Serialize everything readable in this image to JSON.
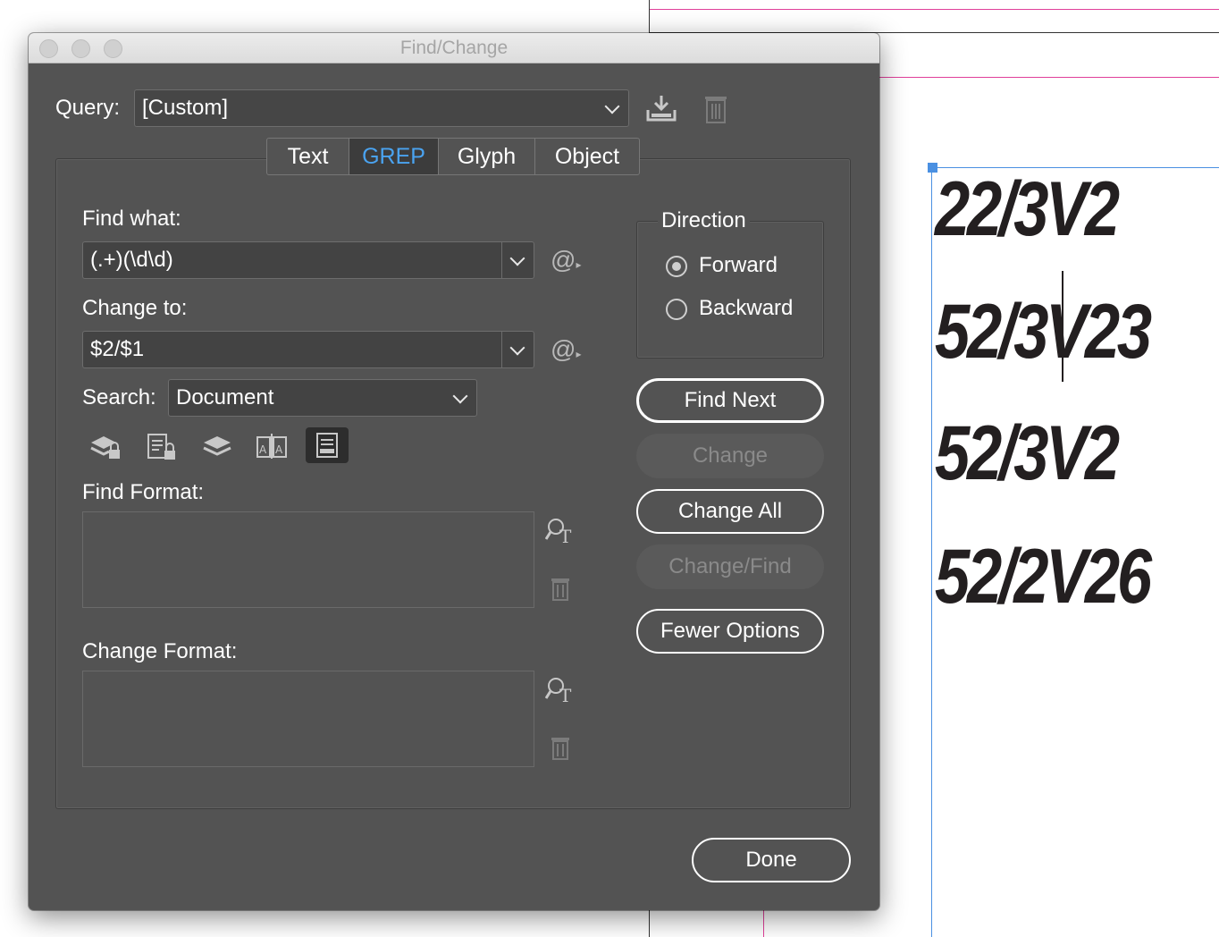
{
  "document": {
    "lines": [
      "22/3V2",
      "52/3V23",
      "52/3V2",
      "52/2V26"
    ]
  },
  "dialog": {
    "title": "Find/Change",
    "query": {
      "label": "Query:",
      "value": "[Custom]"
    },
    "tabs": [
      {
        "label": "Text",
        "active": false
      },
      {
        "label": "GREP",
        "active": true
      },
      {
        "label": "Glyph",
        "active": false
      },
      {
        "label": "Object",
        "active": false
      }
    ],
    "find_what": {
      "label": "Find what:",
      "value": "(.+)(\\d\\d)"
    },
    "change_to": {
      "label": "Change to:",
      "value": "$2/$1"
    },
    "search": {
      "label": "Search:",
      "value": "Document"
    },
    "search_options": [
      "include-locked-layers-icon",
      "include-locked-stories-icon",
      "include-hidden-layers-icon",
      "include-master-pages-icon",
      "include-footnotes-icon"
    ],
    "find_format": {
      "label": "Find Format:"
    },
    "change_format": {
      "label": "Change Format:"
    },
    "direction": {
      "title": "Direction",
      "options": [
        {
          "label": "Forward",
          "selected": true
        },
        {
          "label": "Backward",
          "selected": false
        }
      ]
    },
    "buttons": {
      "find_next": "Find Next",
      "change": "Change",
      "change_all": "Change All",
      "change_find": "Change/Find",
      "fewer_options": "Fewer Options",
      "done": "Done"
    }
  },
  "colors": {
    "dialog_bg": "#535353",
    "active_tab_text": "#4aa3f0",
    "guide_magenta": "#e0409a",
    "guide_blue": "#4a90e2"
  }
}
